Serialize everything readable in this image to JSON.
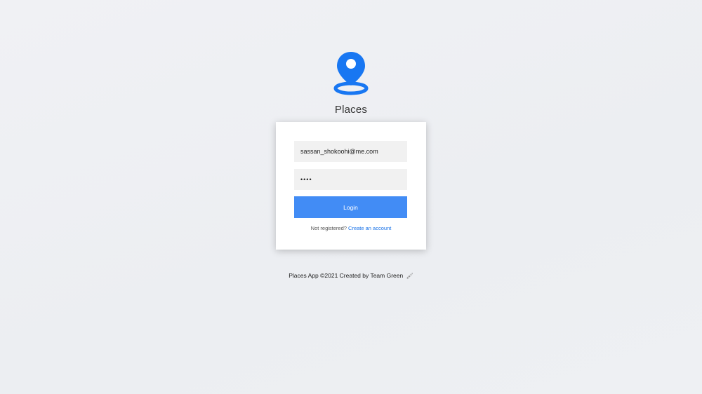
{
  "brand": {
    "title": "Places",
    "logo_icon": "map-pin-icon",
    "accent_color": "#1877f2"
  },
  "login_form": {
    "email_value": "sassan_shokoohi@me.com",
    "password_value": "••••",
    "login_label": "Login",
    "register_prompt": "Not registered?",
    "register_link": "Create an account",
    "button_color": "#428cf5"
  },
  "footer": {
    "text": "Places App ©2021 Created by Team Green",
    "icon": "brush-icon",
    "icon_glyph": "🖌"
  }
}
